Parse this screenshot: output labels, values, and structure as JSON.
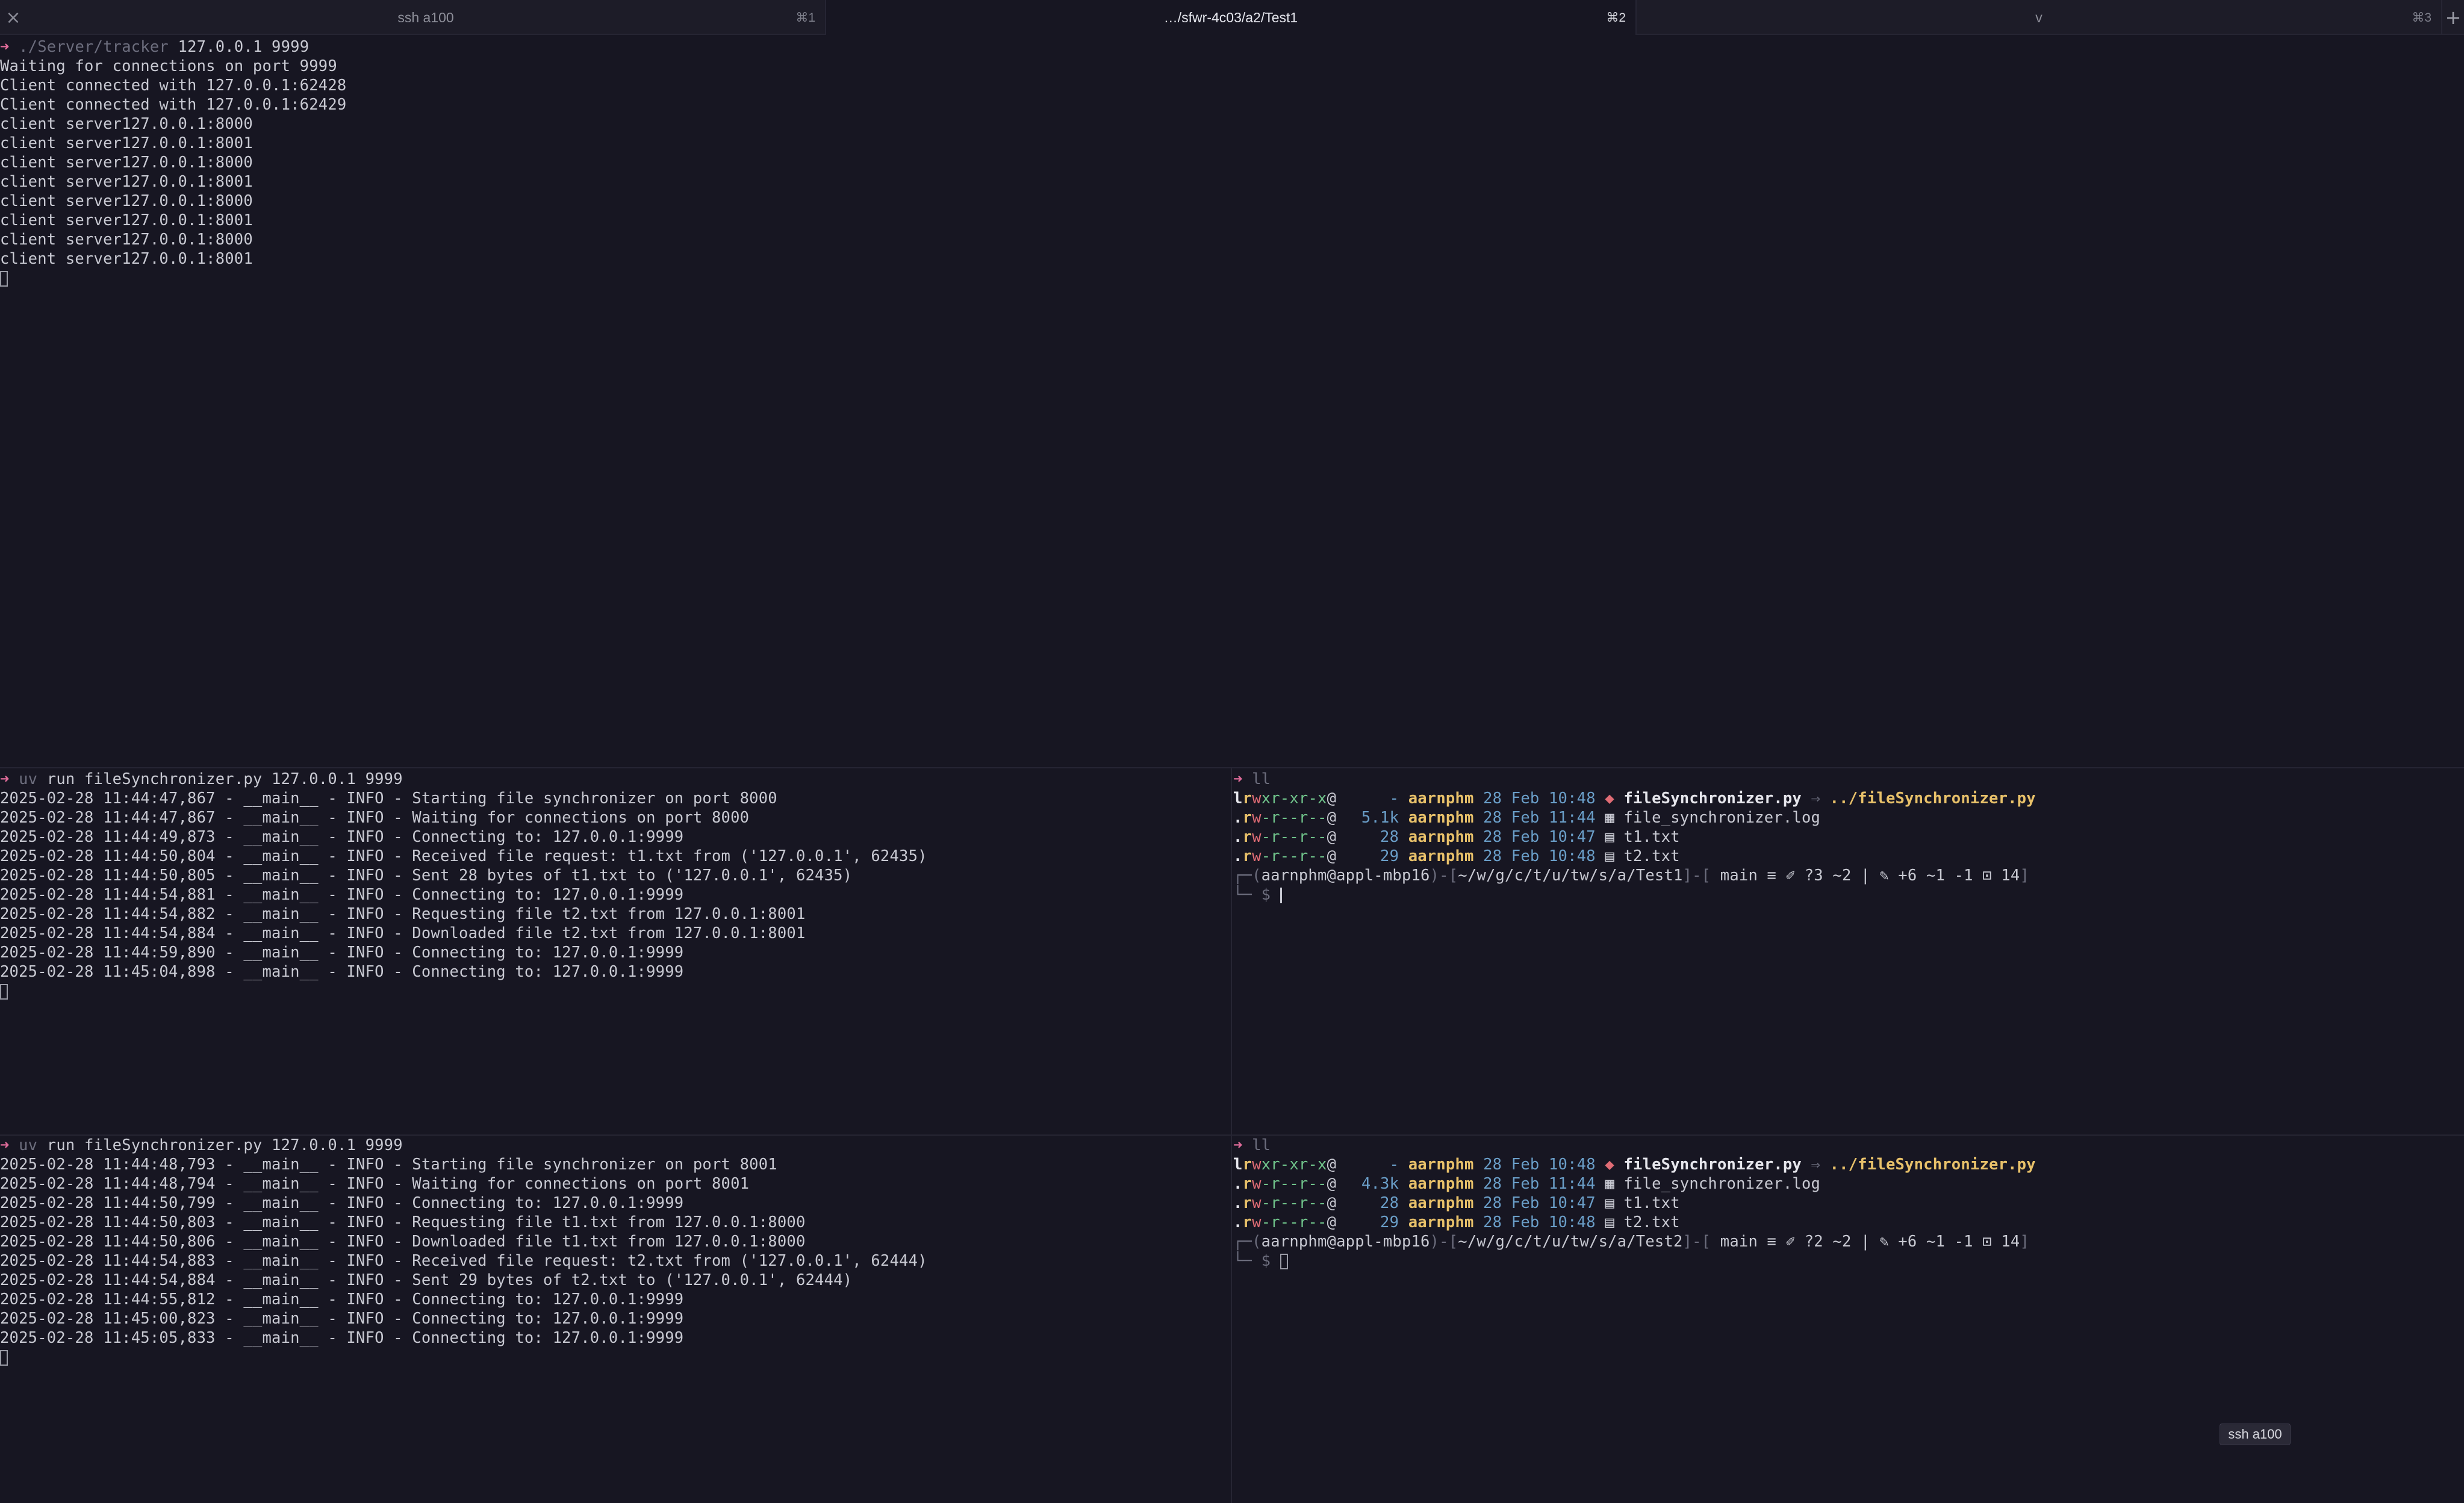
{
  "tabs": [
    {
      "label": "ssh a100",
      "shortcut": "⌘1",
      "active": false
    },
    {
      "label": "…/sfwr-4c03/a2/Test1",
      "shortcut": "⌘2",
      "active": true
    },
    {
      "label": "v",
      "shortcut": "⌘3",
      "active": false
    }
  ],
  "top_pane": {
    "command": {
      "prompt": "➜",
      "program": "./Server/tracker",
      "args": " 127.0.0.1 9999"
    },
    "output": [
      "Waiting for connections on port 9999",
      "Client connected with 127.0.0.1:62428",
      "Client connected with 127.0.0.1:62429",
      "client server127.0.0.1:8000",
      "client server127.0.0.1:8001",
      "client server127.0.0.1:8000",
      "client server127.0.0.1:8001",
      "client server127.0.0.1:8000",
      "client server127.0.0.1:8001",
      "client server127.0.0.1:8000",
      "client server127.0.0.1:8001"
    ]
  },
  "mid_left_pane": {
    "command": {
      "prompt": "➜",
      "program": "uv",
      "args": " run fileSynchronizer.py 127.0.0.1 9999"
    },
    "output": [
      "2025-02-28 11:44:47,867 - __main__ - INFO - Starting file synchronizer on port 8000",
      "2025-02-28 11:44:47,867 - __main__ - INFO - Waiting for connections on port 8000",
      "2025-02-28 11:44:49,873 - __main__ - INFO - Connecting to: 127.0.0.1:9999",
      "2025-02-28 11:44:50,804 - __main__ - INFO - Received file request: t1.txt from ('127.0.0.1', 62435)",
      "2025-02-28 11:44:50,805 - __main__ - INFO - Sent 28 bytes of t1.txt to ('127.0.0.1', 62435)",
      "2025-02-28 11:44:54,881 - __main__ - INFO - Connecting to: 127.0.0.1:9999",
      "2025-02-28 11:44:54,882 - __main__ - INFO - Requesting file t2.txt from 127.0.0.1:8001",
      "2025-02-28 11:44:54,884 - __main__ - INFO - Downloaded file t2.txt from 127.0.0.1:8001",
      "2025-02-28 11:44:59,890 - __main__ - INFO - Connecting to: 127.0.0.1:9999",
      "2025-02-28 11:45:04,898 - __main__ - INFO - Connecting to: 127.0.0.1:9999"
    ]
  },
  "bottom_left_pane": {
    "command": {
      "prompt": "➜",
      "program": "uv",
      "args": " run fileSynchronizer.py 127.0.0.1 9999"
    },
    "output": [
      "2025-02-28 11:44:48,793 - __main__ - INFO - Starting file synchronizer on port 8001",
      "2025-02-28 11:44:48,794 - __main__ - INFO - Waiting for connections on port 8001",
      "2025-02-28 11:44:50,799 - __main__ - INFO - Connecting to: 127.0.0.1:9999",
      "2025-02-28 11:44:50,803 - __main__ - INFO - Requesting file t1.txt from 127.0.0.1:8000",
      "2025-02-28 11:44:50,806 - __main__ - INFO - Downloaded file t1.txt from 127.0.0.1:8000",
      "2025-02-28 11:44:54,883 - __main__ - INFO - Received file request: t2.txt from ('127.0.0.1', 62444)",
      "2025-02-28 11:44:54,884 - __main__ - INFO - Sent 29 bytes of t2.txt to ('127.0.0.1', 62444)",
      "2025-02-28 11:44:55,812 - __main__ - INFO - Connecting to: 127.0.0.1:9999",
      "2025-02-28 11:45:00,823 - __main__ - INFO - Connecting to: 127.0.0.1:9999",
      "2025-02-28 11:45:05,833 - __main__ - INFO - Connecting to: 127.0.0.1:9999"
    ]
  },
  "mid_right_pane": {
    "command": {
      "prompt": "➜",
      "program": "ll"
    },
    "listing": [
      {
        "perm_prefix": "l",
        "perm_r": "r",
        "perm_w": "w",
        "perm_rest": "xr-xr-x",
        "at": "@",
        "size": "-",
        "owner": "aarnphm",
        "date": "28 Feb 10:48",
        "icon": "◆",
        "name": "fileSynchronizer.py",
        "link_arrow": " ⇒ ",
        "link_target": "../fileSynchronizer.py"
      },
      {
        "perm_prefix": ".",
        "perm_r": "r",
        "perm_w": "w",
        "perm_rest": "-r--r--",
        "at": "@",
        "size": "5.1k",
        "owner": "aarnphm",
        "date": "28 Feb 11:44",
        "icon": "▦",
        "name": "file_synchronizer.log",
        "link_arrow": "",
        "link_target": ""
      },
      {
        "perm_prefix": ".",
        "perm_r": "r",
        "perm_w": "w",
        "perm_rest": "-r--r--",
        "at": "@",
        "size": "28",
        "owner": "aarnphm",
        "date": "28 Feb 10:47",
        "icon": "▤",
        "name": "t1.txt",
        "link_arrow": "",
        "link_target": ""
      },
      {
        "perm_prefix": ".",
        "perm_r": "r",
        "perm_w": "w",
        "perm_rest": "-r--r--",
        "at": "@",
        "size": "29",
        "owner": "aarnphm",
        "date": "28 Feb 10:48",
        "icon": "▤",
        "name": "t2.txt",
        "link_arrow": "",
        "link_target": ""
      }
    ],
    "prompt_line": {
      "open": "┌─(",
      "user": "aarnphm@appl-mbp16",
      "mid": ")-[",
      "path": "~/w/g/c/t/u/tw/s/a/Test1",
      "mid2": "]-[",
      "git_icon": "",
      "git": " main ≡ ✐ ?3 ~2 | ✎ +6 ~1 -1 ⊡ 14",
      "close": "]"
    },
    "input_line": "└─ $ "
  },
  "bottom_right_pane": {
    "command": {
      "prompt": "➜",
      "program": "ll"
    },
    "listing": [
      {
        "perm_prefix": "l",
        "perm_r": "r",
        "perm_w": "w",
        "perm_rest": "xr-xr-x",
        "at": "@",
        "size": "-",
        "owner": "aarnphm",
        "date": "28 Feb 10:48",
        "icon": "◆",
        "name": "fileSynchronizer.py",
        "link_arrow": " ⇒ ",
        "link_target": "../fileSynchronizer.py"
      },
      {
        "perm_prefix": ".",
        "perm_r": "r",
        "perm_w": "w",
        "perm_rest": "-r--r--",
        "at": "@",
        "size": "4.3k",
        "owner": "aarnphm",
        "date": "28 Feb 11:44",
        "icon": "▦",
        "name": "file_synchronizer.log",
        "link_arrow": "",
        "link_target": ""
      },
      {
        "perm_prefix": ".",
        "perm_r": "r",
        "perm_w": "w",
        "perm_rest": "-r--r--",
        "at": "@",
        "size": "28",
        "owner": "aarnphm",
        "date": "28 Feb 10:47",
        "icon": "▤",
        "name": "t1.txt",
        "link_arrow": "",
        "link_target": ""
      },
      {
        "perm_prefix": ".",
        "perm_r": "r",
        "perm_w": "w",
        "perm_rest": "-r--r--",
        "at": "@",
        "size": "29",
        "owner": "aarnphm",
        "date": "28 Feb 10:48",
        "icon": "▤",
        "name": "t2.txt",
        "link_arrow": "",
        "link_target": ""
      }
    ],
    "prompt_line": {
      "open": "┌─(",
      "user": "aarnphm@appl-mbp16",
      "mid": ")-[",
      "path": "~/w/g/c/t/u/tw/s/a/Test2",
      "mid2": "]-[",
      "git_icon": "",
      "git": " main ≡ ✐ ?2 ~2 | ✎ +6 ~1 -1 ⊡ 14",
      "close": "]"
    },
    "input_line": "└─ $ "
  },
  "tooltip": "ssh a100",
  "colors": {
    "background": "#171622",
    "prompt_arrow": "#e06c9a",
    "owner": "#e8c16a",
    "perm_read": "#e8c16a",
    "perm_write": "#e06c75",
    "perm_exec": "#6fc28a",
    "size": "#6a9ec8"
  }
}
